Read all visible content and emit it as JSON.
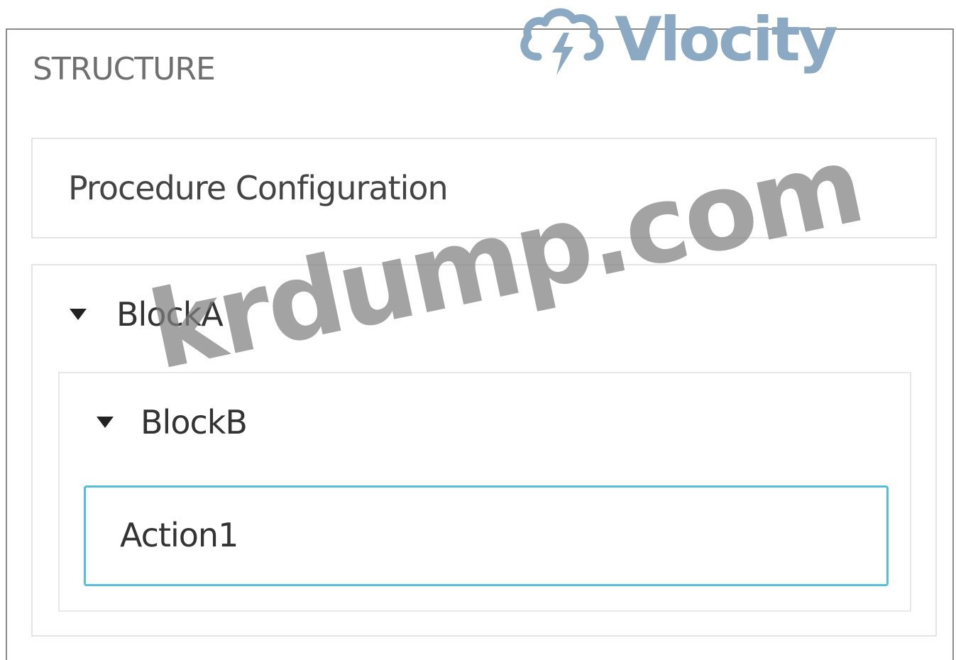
{
  "structure": {
    "title": "STRUCTURE",
    "procedure_configuration": "Procedure Configuration",
    "block_a": {
      "label": "BlockA",
      "expanded": true,
      "block_b": {
        "label": "BlockB",
        "expanded": true,
        "action": {
          "label": "Action1",
          "selected": true
        }
      }
    }
  },
  "logo": {
    "text": "Vlocity",
    "icon": "cloud-lightning-icon",
    "color": "#8ba9c3"
  },
  "watermark": {
    "text": "krdump.com"
  },
  "colors": {
    "selected_border": "#56bfd6",
    "panel_border": "#8a8a8a"
  }
}
